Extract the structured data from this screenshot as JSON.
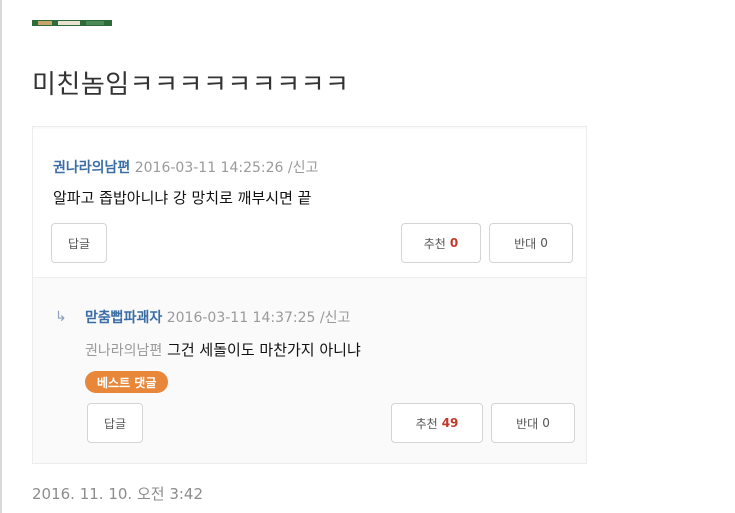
{
  "post": {
    "title": "미친놈임ㅋㅋㅋㅋㅋㅋㅋㅋㅋ",
    "timestamp": "2016. 11. 10. 오전 3:42"
  },
  "comments": [
    {
      "author": "권나라의남편",
      "date": "2016-03-11 14:25:26",
      "separator": "/",
      "report": "신고",
      "text": "알파고 좁밥아니냐 강 망치로 깨부시면 끝",
      "reply_label": "답글",
      "upvote_label": "추천",
      "upvote_count": "0",
      "downvote_label": "반대",
      "downvote_count": "0"
    },
    {
      "author": "맏춤뻡파괘자",
      "date": "2016-03-11 14:37:25",
      "separator": "/",
      "report": "신고",
      "reply_to": "권나라의남편",
      "text": "그건 세돌이도 마찬가지 아니냐",
      "badge": "베스트 댓글",
      "reply_label": "답글",
      "upvote_label": "추천",
      "upvote_count": "49",
      "downvote_label": "반대",
      "downvote_count": "0"
    }
  ],
  "colors": {
    "author": "#3b6ea5",
    "badge": "#e8863a",
    "count": "#c0392b"
  }
}
